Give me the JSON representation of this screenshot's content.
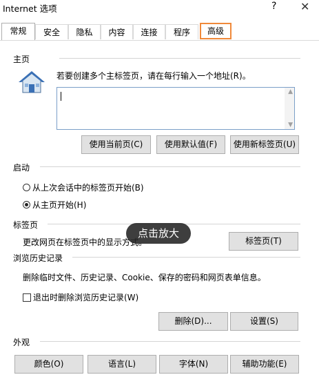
{
  "window": {
    "title": "Internet 选项",
    "help_glyph": "?",
    "close_glyph": "✕"
  },
  "tabs": [
    {
      "label": "常规",
      "active": true
    },
    {
      "label": "安全"
    },
    {
      "label": "隐私"
    },
    {
      "label": "内容"
    },
    {
      "label": "连接"
    },
    {
      "label": "程序"
    },
    {
      "label": "高级",
      "highlighted": true
    }
  ],
  "home": {
    "heading": "主页",
    "description": "若要创建多个主标签页，请在每行输入一个地址(R)。",
    "address_value": "",
    "buttons": {
      "current": "使用当前页(C)",
      "default": "使用默认值(F)",
      "new_tab": "使用新标签页(U)"
    }
  },
  "startup": {
    "heading": "启动",
    "option_last_session": "从上次会话中的标签页开始(B)",
    "option_home": "从主页开始(H)",
    "selected": "home"
  },
  "tabs_section": {
    "heading": "标签页",
    "description": "更改网页在标签页中的显示方式。",
    "button": "标签页(T)"
  },
  "history": {
    "heading": "浏览历史记录",
    "description": "删除临时文件、历史记录、Cookie、保存的密码和网页表单信息。",
    "checkbox_label": "退出时删除浏览历史记录(W)",
    "checked": false,
    "delete_button": "删除(D)...",
    "settings_button": "设置(S)"
  },
  "appearance": {
    "heading": "外观",
    "buttons": {
      "colors": "颜色(O)",
      "languages": "语言(L)",
      "fonts": "字体(N)",
      "accessibility": "辅助功能(E)"
    }
  },
  "overlay": {
    "label": "点击放大"
  },
  "colors": {
    "highlight": "#f0893a",
    "button_bg": "#e1e1e1",
    "button_border": "#adadad",
    "overlay_bg": "#232323"
  }
}
